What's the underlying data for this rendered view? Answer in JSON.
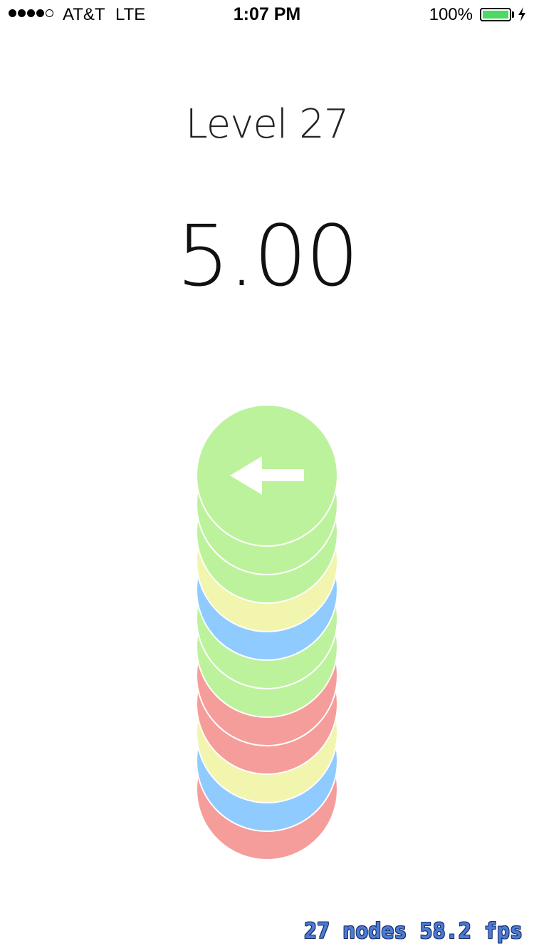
{
  "status_bar": {
    "signal_strength": "4 of 5",
    "carrier": "AT&T",
    "network": "LTE",
    "time": "1:07 PM",
    "battery_percent": "100%",
    "battery_level": 1.0,
    "battery_color": "#4cd964",
    "charging_icon": "bolt-icon"
  },
  "game": {
    "level_title": "Level 27",
    "timer": "5.00",
    "top_button_icon": "arrow-left-icon",
    "stack_top_to_bottom": [
      "green",
      "green",
      "green",
      "yellow",
      "blue",
      "green",
      "green",
      "red",
      "red",
      "yellow",
      "blue",
      "red"
    ],
    "colors": {
      "green": "#bdf29c",
      "yellow": "#f2f5ad",
      "blue": "#8fcbff",
      "red": "#f59d9b",
      "outline": "#ffffff"
    }
  },
  "debug": {
    "stats": "27 nodes 58.2 fps"
  }
}
